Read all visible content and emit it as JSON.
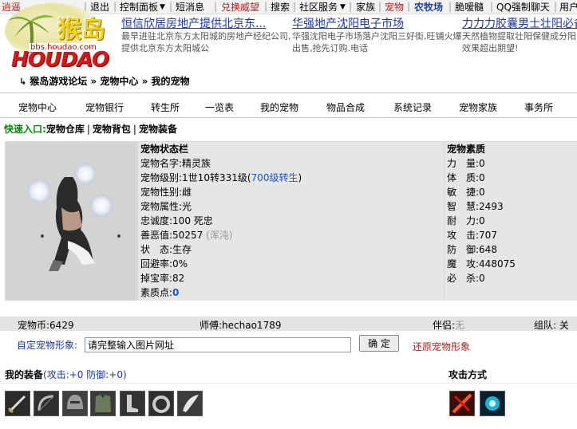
{
  "topnav": {
    "items": [
      "逍遥",
      "退出",
      "控制面板",
      "短消息",
      "兑换威望",
      "社区服务",
      "家族",
      "宠物",
      "农牧场",
      "脆嗳髓",
      "QQ强制聊天",
      "用户"
    ],
    "colors": {
      "active": "#c8151b",
      "emphasis": "#1a3ea8",
      "normal": "#000000"
    }
  },
  "logo": {
    "title": "猴岛",
    "brand": "HOUDAO",
    "url": "bbs.houdao.com"
  },
  "ads": [
    {
      "title": "恒信欣居房地产提供北京东...",
      "desc": "最早进驻北京东方太阳城的房地产经纪公司,提供北京东方太阳城公"
    },
    {
      "title": "华强地产沈阳电子市场",
      "desc": "华强沈阳电子市场落户沈阳三好街,旺铺火爆出售,抢先订购.电话"
    },
    {
      "title": "力力力胶囊男士壮阳必备",
      "desc": "天然植物提取壮阳保健成分阳效果超出期望!"
    }
  ],
  "breadcrumb": {
    "forum": "猴岛游戏论坛",
    "center": "宠物中心",
    "mine": "我的宠物",
    "sep": "»"
  },
  "mainmenu": [
    "宠物中心",
    "宠物银行",
    "转生所",
    "一览表",
    "我的宠物",
    "物品合成",
    "系统记录",
    "宠物家族",
    "事务所"
  ],
  "quick": {
    "label": "快速入口:",
    "links": [
      "宠物仓库",
      "宠物背包",
      "宠物装备"
    ],
    "sep": "|"
  },
  "status": {
    "header": "宠物状态栏",
    "name_label": "宠物名字:",
    "name": "精灵族",
    "level_label": "宠物级别:",
    "level": "1世10转331级(",
    "level_link": "700级转生",
    "level_end": ")",
    "gender_label": "宠物性别:",
    "gender": "雌",
    "attr_label": "宠物属性:",
    "attr": "光",
    "loyalty_label": "忠诚度:",
    "loyalty": "100 死忠",
    "karma_label": "善恶值:",
    "karma": "50257",
    "karma_note": "(浑沌)",
    "state_label": "状　态:",
    "state": "生存",
    "evasion_label": "回避率:",
    "evasion": "0%",
    "drop_label": "掉宝率:",
    "drop": "82",
    "points_label": "素质点:",
    "points": "0"
  },
  "qualities": {
    "header": "宠物素质",
    "items": [
      {
        "label": "力　量:",
        "value": "0"
      },
      {
        "label": "体　质:",
        "value": "0"
      },
      {
        "label": "敏　捷:",
        "value": "0"
      },
      {
        "label": "智　慧:",
        "value": "2493"
      },
      {
        "label": "耐　力:",
        "value": "0"
      },
      {
        "label": "攻　击:",
        "value": "707"
      },
      {
        "label": "防　御:",
        "value": "648"
      },
      {
        "label": "魔　攻:",
        "value": "448075"
      },
      {
        "label": "必　杀:",
        "value": "0"
      }
    ]
  },
  "footbar": {
    "coin": "宠物币:6429",
    "master": "师傅:hechao1789",
    "partner_label": "伴侣:",
    "partner": "无",
    "group": "组队: 关"
  },
  "custom_image": {
    "label": "自定宠物形象:",
    "value": "请完整输入图片网址",
    "confirm": "确 定",
    "restore": "还原宠物形象"
  },
  "equipment": {
    "title": "我的装备",
    "stats": "(攻击:+0 防御:+0)",
    "attack_title": "攻击方式"
  }
}
